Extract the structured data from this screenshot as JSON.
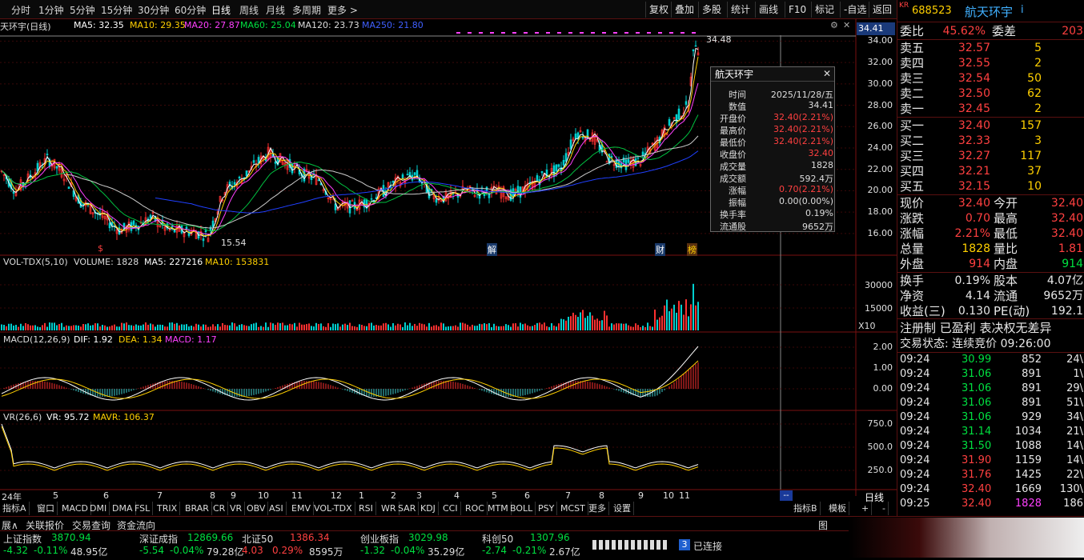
{
  "toolbar": {
    "periods": [
      "分时",
      "1分钟",
      "5分钟",
      "15分钟",
      "30分钟",
      "60分钟",
      "日线",
      "周线",
      "月线",
      "多周期",
      "更多 >"
    ],
    "active_period": "日线",
    "tools": [
      "复权",
      "叠加",
      "多股",
      "统计",
      "画线",
      "F10",
      "标记",
      "-自选",
      "返回"
    ]
  },
  "chart_header": {
    "stock_name": "天环宇(日线)",
    "ma5": "MA5: 32.35",
    "ma10": "MA10: 29.35",
    "ma20": "MA20: 27.87",
    "ma60": "MA60: 25.04",
    "ma120": "MA120: 23.73",
    "ma250": "MA250: 21.80",
    "current_price_tag": "34.41"
  },
  "price_axis": [
    "34.00",
    "32.00",
    "30.00",
    "28.00",
    "26.00",
    "24.00",
    "22.00",
    "20.00",
    "18.00",
    "16.00"
  ],
  "price_markers": {
    "high": "34.48",
    "low": "15.54",
    "s_mark": "$",
    "jie": "解",
    "cai": "财",
    "bang": "榜"
  },
  "volume_panel": {
    "title": "VOL-TDX(5,10)",
    "volume": "VOLUME: 1828",
    "ma5": "MA5: 227216",
    "ma10": "MA10: 153831",
    "axis": [
      "30000",
      "15000"
    ],
    "unit": "X10"
  },
  "macd_panel": {
    "title": "MACD(12,26,9)",
    "dif": "DIF: 1.92",
    "dea": "DEA: 1.34",
    "macd": "MACD: 1.17",
    "axis": [
      "2.00",
      "1.00",
      "0.00"
    ]
  },
  "vr_panel": {
    "title": "VR(26,6)",
    "vr": "VR: 95.72",
    "mavr": "MAVR: 106.37",
    "axis": [
      "750.0",
      "500.0",
      "250.0"
    ]
  },
  "months": [
    "24年",
    "5",
    "6",
    "7",
    "8",
    "9",
    "10",
    "11",
    "12",
    "1",
    "2",
    "3",
    "4",
    "5",
    "6",
    "7",
    "8",
    "9",
    "10",
    "11"
  ],
  "indicator_tabs": [
    "指标A",
    "窗口",
    "MACD",
    "DMI",
    "DMA",
    "FSL",
    "TRIX",
    "BRAR",
    "CR",
    "VR",
    "OBV",
    "ASI",
    "EMV",
    "VOL-TDX",
    "RSI",
    "WR",
    "SAR",
    "KDJ",
    "CCI",
    "ROC",
    "MTM",
    "BOLL",
    "PSY",
    "MCST",
    "更多",
    "设置"
  ],
  "indicator_right": [
    "指标B",
    "模板",
    "+",
    "-"
  ],
  "period_label": "日线",
  "tooltip": {
    "title": "航天环宇",
    "rows": [
      {
        "k": "时间",
        "v": "2025/11/28/五",
        "c": "#dddddd"
      },
      {
        "k": "数值",
        "v": "34.41",
        "c": "#dddddd"
      },
      {
        "k": "开盘价",
        "v": "32.40(2.21%)",
        "c": "#ff4040"
      },
      {
        "k": "最高价",
        "v": "32.40(2.21%)",
        "c": "#ff4040"
      },
      {
        "k": "最低价",
        "v": "32.40(2.21%)",
        "c": "#ff4040"
      },
      {
        "k": "收盘价",
        "v": "32.40",
        "c": "#ff4040"
      },
      {
        "k": "成交量",
        "v": "1828",
        "c": "#dddddd"
      },
      {
        "k": "成交额",
        "v": "592.4万",
        "c": "#dddddd"
      },
      {
        "k": "涨幅",
        "v": "0.70(2.21%)",
        "c": "#ff4040"
      },
      {
        "k": "振幅",
        "v": "0.00(0.00%)",
        "c": "#dddddd"
      },
      {
        "k": "换手率",
        "v": "0.19%",
        "c": "#dddddd"
      },
      {
        "k": "流通股",
        "v": "9652万",
        "c": "#dddddd"
      }
    ]
  },
  "quote": {
    "badge": "KR",
    "code": "688523",
    "name": "航天环宇",
    "suffix": "i",
    "weibi_label": "委比",
    "weibi": "45.62%",
    "weicha_label": "委差",
    "weicha": "203",
    "sells": [
      {
        "label": "卖五",
        "price": "32.57",
        "vol": "5"
      },
      {
        "label": "卖四",
        "price": "32.55",
        "vol": "2"
      },
      {
        "label": "卖三",
        "price": "32.54",
        "vol": "50"
      },
      {
        "label": "卖二",
        "price": "32.50",
        "vol": "62"
      },
      {
        "label": "卖一",
        "price": "32.45",
        "vol": "2"
      }
    ],
    "buys": [
      {
        "label": "买一",
        "price": "32.40",
        "vol": "157"
      },
      {
        "label": "买二",
        "price": "32.33",
        "vol": "3"
      },
      {
        "label": "买三",
        "price": "32.27",
        "vol": "117"
      },
      {
        "label": "买四",
        "price": "32.21",
        "vol": "37"
      },
      {
        "label": "买五",
        "price": "32.15",
        "vol": "10"
      }
    ],
    "stats": [
      {
        "l1": "现价",
        "v1": "32.40",
        "c1": "#ff4040",
        "l2": "今开",
        "v2": "32.40",
        "c2": "#ff4040"
      },
      {
        "l1": "涨跌",
        "v1": "0.70",
        "c1": "#ff4040",
        "l2": "最高",
        "v2": "32.40",
        "c2": "#ff4040"
      },
      {
        "l1": "涨幅",
        "v1": "2.21%",
        "c1": "#ff4040",
        "l2": "最低",
        "v2": "32.40",
        "c2": "#ff4040"
      },
      {
        "l1": "总量",
        "v1": "1828",
        "c1": "#ffd000",
        "l2": "量比",
        "v2": "1.81",
        "c2": "#ff4040"
      },
      {
        "l1": "外盘",
        "v1": "914",
        "c1": "#ff4040",
        "l2": "内盘",
        "v2": "914",
        "c2": "#00e040"
      }
    ],
    "stats2": [
      {
        "l1": "换手",
        "v1": "0.19%",
        "l2": "股本",
        "v2": "4.07亿"
      },
      {
        "l1": "净资",
        "v1": "4.14",
        "l2": "流通",
        "v2": "9652万"
      },
      {
        "l1": "收益(三)",
        "v1": "0.130",
        "l2": "PE(动)",
        "v2": "192.1"
      }
    ],
    "tags": "注册制 已盈利 表决权无差异",
    "trade_status": "交易状态: 连续竞价 09:26:00"
  },
  "ticks": [
    {
      "t": "09:24",
      "p": "30.99",
      "pc": "#00e040",
      "v": "852",
      "d": "24\\"
    },
    {
      "t": "09:24",
      "p": "31.06",
      "pc": "#00e040",
      "v": "891",
      "d": "1\\"
    },
    {
      "t": "09:24",
      "p": "31.06",
      "pc": "#00e040",
      "v": "891",
      "d": "29\\"
    },
    {
      "t": "09:24",
      "p": "31.06",
      "pc": "#00e040",
      "v": "891",
      "d": "51\\"
    },
    {
      "t": "09:24",
      "p": "31.06",
      "pc": "#00e040",
      "v": "929",
      "d": "34\\"
    },
    {
      "t": "09:24",
      "p": "31.14",
      "pc": "#00e040",
      "v": "1034",
      "d": "21\\"
    },
    {
      "t": "09:24",
      "p": "31.50",
      "pc": "#00e040",
      "v": "1088",
      "d": "14\\"
    },
    {
      "t": "09:24",
      "p": "31.90",
      "pc": "#ff4040",
      "v": "1159",
      "d": "14\\"
    },
    {
      "t": "09:24",
      "p": "31.76",
      "pc": "#ff4040",
      "v": "1425",
      "d": "22\\"
    },
    {
      "t": "09:24",
      "p": "32.40",
      "pc": "#ff4040",
      "v": "1669",
      "d": "130\\"
    },
    {
      "t": "09:25",
      "p": "32.40",
      "pc": "#ff4040",
      "v": "1828",
      "d": "186"
    }
  ],
  "bottom_tabs": [
    "展∧",
    "关联报价",
    "交易查询",
    "资金流向"
  ],
  "indices": [
    {
      "name": "上证指数",
      "val": "3870.94",
      "chg": "-4.32",
      "pct": "-0.11%",
      "amt": "48.95亿",
      "c": "#00e040"
    },
    {
      "name": "深证成指",
      "val": "12869.66",
      "chg": "-5.54",
      "pct": "-0.04%",
      "amt": "79.28亿",
      "c": "#00e040"
    },
    {
      "name": "北证50",
      "val": "1386.34",
      "chg": "4.03",
      "pct": "0.29%",
      "amt": "8595万",
      "c": "#ff4040"
    },
    {
      "name": "创业板指",
      "val": "3029.98",
      "chg": "-1.32",
      "pct": "-0.04%",
      "amt": "35.29亿",
      "c": "#00e040"
    },
    {
      "name": "科创50",
      "val": "1307.96",
      "chg": "-2.74",
      "pct": "-0.21%",
      "amt": "2.67亿",
      "c": "#00e040"
    }
  ],
  "connection": {
    "count": "3",
    "text": "已连接"
  },
  "chart_data": {
    "type": "line",
    "title": "航天环宇(日线)",
    "y_range": [
      15.54,
      34.48
    ],
    "last": {
      "open": 32.4,
      "high": 32.4,
      "low": 32.4,
      "close": 32.4,
      "value": 34.41,
      "volume": 1828
    },
    "series": [
      {
        "name": "MA5",
        "last": 32.35
      },
      {
        "name": "MA10",
        "last": 29.35
      },
      {
        "name": "MA20",
        "last": 27.87
      },
      {
        "name": "MA60",
        "last": 25.04
      },
      {
        "name": "MA120",
        "last": 23.73
      },
      {
        "name": "MA250",
        "last": 21.8
      }
    ]
  }
}
